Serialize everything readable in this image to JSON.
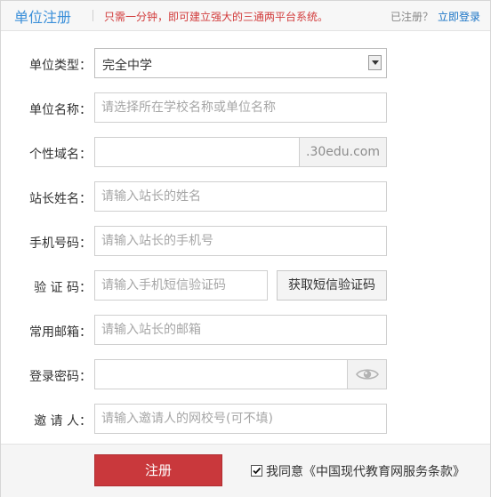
{
  "header": {
    "title": "单位注册",
    "slogan": "只需一分钟，即可建立强大的三通两平台系统。",
    "registered_text": "已注册？",
    "login_link": "立即登录"
  },
  "form": {
    "unit_type": {
      "label": "单位类型：",
      "value": "完全中学"
    },
    "unit_name": {
      "label": "单位名称：",
      "placeholder": "请选择所在学校名称或单位名称"
    },
    "domain": {
      "label": "个性域名：",
      "value": "",
      "suffix": ".30edu.com"
    },
    "admin_name": {
      "label": "站长姓名：",
      "placeholder": "请输入站长的姓名"
    },
    "phone": {
      "label": "手机号码：",
      "placeholder": "请输入站长的手机号"
    },
    "code": {
      "label": "验 证 码：",
      "placeholder": "请输入手机短信验证码",
      "button": "获取短信验证码"
    },
    "email": {
      "label": "常用邮箱：",
      "placeholder": "请输入站长的邮箱"
    },
    "password": {
      "label": "登录密码：",
      "value": "",
      "toggle_icon": "eye-icon"
    },
    "inviter": {
      "label": "邀 请 人：",
      "placeholder": "请输入邀请人的网校号(可不填)"
    }
  },
  "footer": {
    "submit": "注册",
    "agree_checked": true,
    "agree_text": "我同意《中国现代教育网服务条款》"
  },
  "colors": {
    "accent": "#3a8fd9",
    "slogan": "#d23c3c",
    "submit": "#c9383c",
    "link": "#1a74c6"
  }
}
